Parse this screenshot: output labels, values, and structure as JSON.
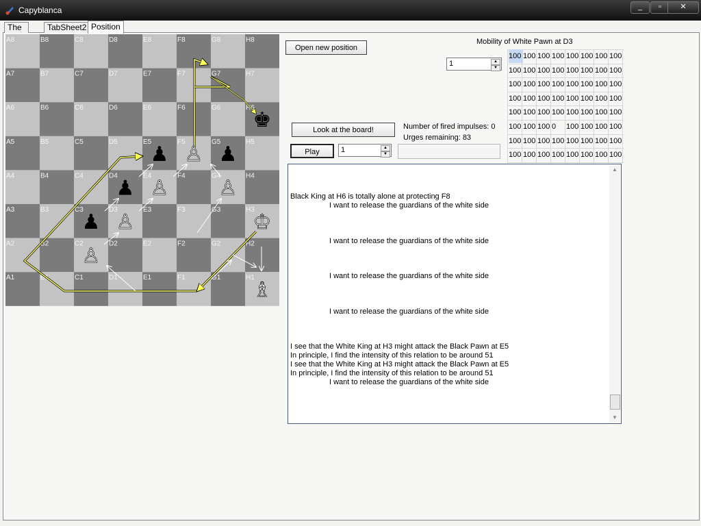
{
  "window": {
    "title": "Capyblanca",
    "controls": {
      "minimize": "_",
      "maximize": "▫",
      "close": "✕"
    }
  },
  "tabs": [
    {
      "label": "The Mind"
    },
    {
      "label": "TabSheet2"
    },
    {
      "label": "Position Loader",
      "active": true
    }
  ],
  "board": {
    "files": [
      "A",
      "B",
      "C",
      "D",
      "E",
      "F",
      "G",
      "H"
    ],
    "ranks": [
      "8",
      "7",
      "6",
      "5",
      "4",
      "3",
      "2",
      "1"
    ],
    "pieces": [
      {
        "square": "H6",
        "piece": "king",
        "color": "black"
      },
      {
        "square": "E5",
        "piece": "pawn",
        "color": "black"
      },
      {
        "square": "G5",
        "piece": "pawn",
        "color": "black"
      },
      {
        "square": "F5",
        "piece": "pawn",
        "color": "white"
      },
      {
        "square": "D4",
        "piece": "pawn",
        "color": "black"
      },
      {
        "square": "E4",
        "piece": "pawn",
        "color": "white"
      },
      {
        "square": "G4",
        "piece": "pawn",
        "color": "white"
      },
      {
        "square": "C3",
        "piece": "pawn",
        "color": "black"
      },
      {
        "square": "D3",
        "piece": "pawn",
        "color": "white"
      },
      {
        "square": "H3",
        "piece": "king",
        "color": "white"
      },
      {
        "square": "C2",
        "piece": "pawn",
        "color": "white"
      },
      {
        "square": "H1",
        "piece": "bishop",
        "color": "white"
      }
    ],
    "colors": {
      "light": "#c3c3c3",
      "dark": "#7b7b7b",
      "highlight": "#ffff66"
    }
  },
  "controls": {
    "open_button": "Open new position",
    "look_button": "Look at the board!",
    "play_button": "Play",
    "play_value": "1",
    "mobility_value": "1",
    "fired_impulses": "Number of fired impulses: 0",
    "urges_remaining": "Urges remaining: 83"
  },
  "mobility": {
    "title": "Mobility of White Pawn at D3",
    "rows": [
      [
        "100",
        "100",
        "100",
        "100",
        "100",
        "100",
        "100",
        "100"
      ],
      [
        "100",
        "100",
        "100",
        "100",
        "100",
        "100",
        "100",
        "100"
      ],
      [
        "100",
        "100",
        "100",
        "100",
        "100",
        "100",
        "100",
        "100"
      ],
      [
        "100",
        "100",
        "100",
        "100",
        "100",
        "100",
        "100",
        "100"
      ],
      [
        "100",
        "100",
        "100",
        "100",
        "100",
        "100",
        "100",
        "100"
      ],
      [
        "100",
        "100",
        "100",
        "0",
        "100",
        "100",
        "100",
        "100"
      ],
      [
        "100",
        "100",
        "100",
        "100",
        "100",
        "100",
        "100",
        "100"
      ],
      [
        "100",
        "100",
        "100",
        "100",
        "100",
        "100",
        "100",
        "100"
      ]
    ]
  },
  "log": {
    "lines": [
      {
        "text": "Black King at H6 is totally alone at protecting F8",
        "indent": false
      },
      {
        "text": "I want to release the guardians of the white side",
        "indent": true
      },
      {
        "text": "",
        "indent": false
      },
      {
        "text": "",
        "indent": false
      },
      {
        "text": "",
        "indent": false
      },
      {
        "text": "I want to release the guardians of the white side",
        "indent": true
      },
      {
        "text": "",
        "indent": false
      },
      {
        "text": "",
        "indent": false
      },
      {
        "text": "",
        "indent": false
      },
      {
        "text": "I want to release the guardians of the white side",
        "indent": true
      },
      {
        "text": "",
        "indent": false
      },
      {
        "text": "",
        "indent": false
      },
      {
        "text": "",
        "indent": false
      },
      {
        "text": "I want to release the guardians of the white side",
        "indent": true
      },
      {
        "text": "",
        "indent": false
      },
      {
        "text": "",
        "indent": false
      },
      {
        "text": "",
        "indent": false
      },
      {
        "text": "I see that the White King at H3 might attack the Black Pawn at E5",
        "indent": false
      },
      {
        "text": "In principle, I find the intensity of this relation to be around 51",
        "indent": false
      },
      {
        "text": "I see that the White King at H3 might attack the Black Pawn at E5",
        "indent": false
      },
      {
        "text": "In principle, I find the intensity of this relation to be around 51",
        "indent": false
      },
      {
        "text": "I want to release the guardians of the white side",
        "indent": true
      }
    ]
  }
}
